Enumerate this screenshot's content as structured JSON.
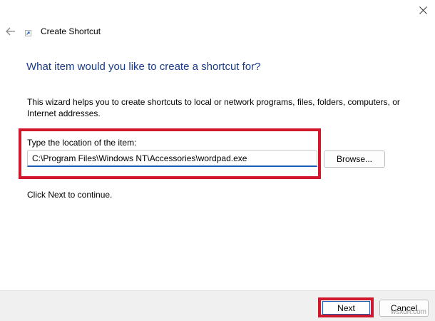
{
  "window": {
    "title": "Create Shortcut",
    "close_icon": "close-icon",
    "back_icon": "back-arrow-icon",
    "title_icon": "shortcut-icon"
  },
  "content": {
    "heading": "What item would you like to create a shortcut for?",
    "description": "This wizard helps you to create shortcuts to local or network programs, files, folders, computers, or Internet addresses.",
    "location_label": "Type the location of the item:",
    "location_value": "C:\\Program Files\\Windows NT\\Accessories\\wordpad.exe",
    "browse_label": "Browse...",
    "continue_text": "Click Next to continue."
  },
  "footer": {
    "next_label": "Next",
    "cancel_label": "Cancel"
  },
  "watermark": "wsxdn.com",
  "colors": {
    "heading": "#1a3c8c",
    "highlight": "#d1172b",
    "accent": "#1a5fb4",
    "footer_bg": "#f0f0f0"
  }
}
